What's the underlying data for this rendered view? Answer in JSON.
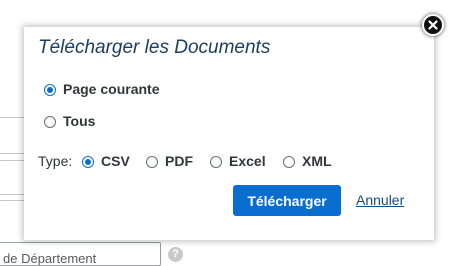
{
  "background": {
    "field_text": "de Département",
    "help_icon_glyph": "?"
  },
  "dialog": {
    "title": "Télécharger les Documents",
    "scope_options": [
      {
        "label": "Page courante",
        "selected": true
      },
      {
        "label": "Tous",
        "selected": false
      }
    ],
    "type_label": "Type:",
    "type_options": [
      {
        "label": "CSV",
        "selected": true
      },
      {
        "label": "PDF",
        "selected": false
      },
      {
        "label": "Excel",
        "selected": false
      },
      {
        "label": "XML",
        "selected": false
      }
    ],
    "download_button": "Télécharger",
    "cancel_link": "Annuler"
  },
  "colors": {
    "accent": "#0a6ed1",
    "title": "#1d3f62",
    "text": "#32363a",
    "link": "#0a4f8f"
  },
  "icons": {
    "close": "close-icon",
    "help": "help-icon"
  }
}
